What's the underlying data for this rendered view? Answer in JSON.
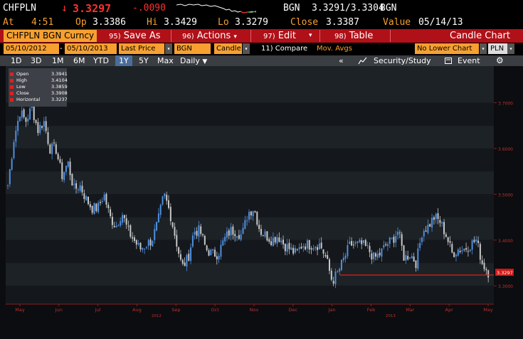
{
  "quote": {
    "ticker": "CHFPLN",
    "arrow": "↓",
    "price": "3.3297",
    "change": "-.0090",
    "bid_source": "BGN",
    "bid_ask": "3.3291/3.3304",
    "source_right": "BGN",
    "at_label": "At",
    "at_time": "4:51",
    "open_label": "Op",
    "open": "3.3386",
    "high_label": "Hi",
    "high": "3.3429",
    "low_label": "Lo",
    "low": "3.3279",
    "close_label": "Close",
    "close": "3.3387",
    "value_label": "Value",
    "value_date": "05/14/13"
  },
  "toolbar": {
    "security": "CHFPLN BGN Curncy",
    "save_num": "95)",
    "save_label": "Save As",
    "actions_num": "96)",
    "actions_label": "Actions",
    "edit_num": "97)",
    "edit_label": "Edit",
    "table_num": "98)",
    "table_label": "Table",
    "chart_type": "Candle Chart",
    "dropdown_glyph": "▾"
  },
  "inputs": {
    "start_date": "05/10/2012",
    "dash": "-",
    "end_date": "05/10/2013",
    "price_field": "Last Price",
    "source": "BGN",
    "style": "Candle",
    "compare": "11) Compare",
    "mov_avgs": "Mov. Avgs",
    "lower_chart": "No Lower Chart",
    "currency": "PLN"
  },
  "ranges": {
    "items": [
      "1D",
      "3D",
      "1M",
      "6M",
      "YTD",
      "1Y",
      "5Y",
      "Max"
    ],
    "selected": "1Y",
    "period": "Daily",
    "period_arrow": "▼",
    "collapse": "«",
    "security_study": "Security/Study",
    "event": "Event",
    "gear": "⚙"
  },
  "legend": {
    "items": [
      {
        "label": "Open",
        "value": "3.3941"
      },
      {
        "label": "High",
        "value": "3.4104"
      },
      {
        "label": "Low",
        "value": "3.3859"
      },
      {
        "label": "Close",
        "value": "3.3908"
      },
      {
        "label": "Horizontal",
        "value": "3.3237"
      }
    ]
  },
  "chart_data": {
    "type": "candlestick",
    "title": "",
    "ylim": [
      3.26,
      3.78
    ],
    "y_ticks": [
      "3.7000",
      "3.6000",
      "3.5000",
      "3.4000",
      "3.3000"
    ],
    "y_tick_values": [
      3.7,
      3.6,
      3.5,
      3.4,
      3.3
    ],
    "last_price_label": "3.3297",
    "last_price": 3.3297,
    "horizontal_line": 3.3237,
    "x_months": [
      "May",
      "Jun",
      "Jul",
      "Aug",
      "Sep",
      "Oct",
      "Nov",
      "Dec",
      "Jan",
      "Feb",
      "Mar",
      "Apr",
      "May"
    ],
    "x_years": [
      "2012",
      "2013"
    ],
    "close_path": [
      3.52,
      3.62,
      3.68,
      3.66,
      3.69,
      3.64,
      3.66,
      3.6,
      3.6,
      3.54,
      3.57,
      3.51,
      3.52,
      3.49,
      3.47,
      3.47,
      3.5,
      3.45,
      3.43,
      3.46,
      3.42,
      3.4,
      3.38,
      3.39,
      3.4,
      3.44,
      3.5,
      3.46,
      3.4,
      3.34,
      3.36,
      3.42,
      3.42,
      3.38,
      3.37,
      3.37,
      3.4,
      3.42,
      3.42,
      3.41,
      3.46,
      3.47,
      3.42,
      3.41,
      3.4,
      3.41,
      3.39,
      3.38,
      3.37,
      3.39,
      3.39,
      3.39,
      3.39,
      3.36,
      3.31,
      3.33,
      3.36,
      3.39,
      3.39,
      3.39,
      3.38,
      3.36,
      3.37,
      3.39,
      3.4,
      3.42,
      3.36,
      3.37,
      3.35,
      3.42,
      3.43,
      3.45,
      3.44,
      3.41,
      3.37,
      3.38,
      3.38,
      3.39,
      3.4,
      3.35,
      3.33
    ],
    "colors": {
      "up": "#4f8fe0",
      "down": "#c8c8c8",
      "horizontal": "#e02020",
      "axis_text": "#c03030",
      "bg_dark": "#14171b",
      "bg_light": "#1d2226"
    }
  }
}
